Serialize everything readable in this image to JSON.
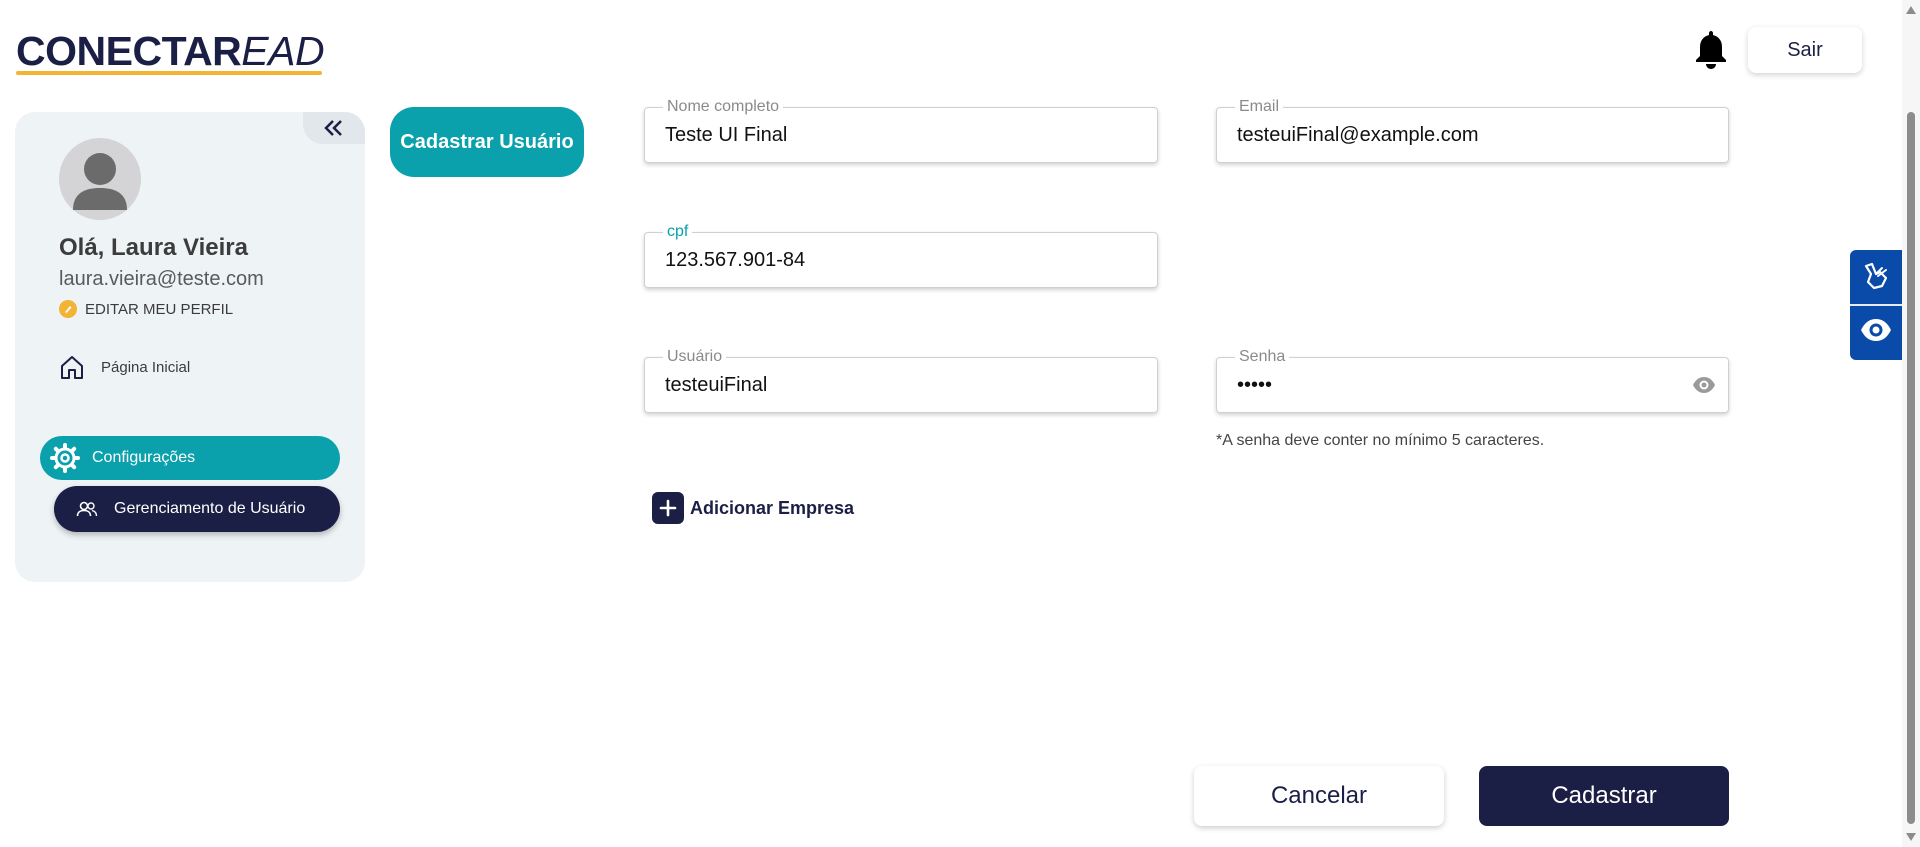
{
  "header": {
    "logo_bold": "CONECTAR",
    "logo_light": "EAD",
    "logout_label": "Sair"
  },
  "sidebar": {
    "greeting": "Olá, Laura Vieira",
    "email": "laura.vieira@teste.com",
    "edit_profile": "EDITAR MEU PERFIL",
    "home": "Página Inicial",
    "settings": "Configurações",
    "user_management": "Gerenciamento de Usuário"
  },
  "page": {
    "title": "Cadastrar Usuário"
  },
  "form": {
    "full_name": {
      "label": "Nome completo",
      "value": "Teste UI Final"
    },
    "email": {
      "label": "Email",
      "value": "testeuiFinal@example.com"
    },
    "cpf": {
      "label": "cpf",
      "value": "123.567.901-84"
    },
    "username": {
      "label": "Usuário",
      "value": "testeuiFinal"
    },
    "password": {
      "label": "Senha",
      "value": "•••••"
    },
    "password_hint": "*A senha deve conter no mínimo 5 caracteres.",
    "add_company": "Adicionar Empresa"
  },
  "actions": {
    "cancel": "Cancelar",
    "submit": "Cadastrar"
  },
  "colors": {
    "navy": "#1b1f45",
    "teal": "#0aa0ac",
    "gold": "#f3b335",
    "a11y_blue": "#0a4aa8"
  }
}
